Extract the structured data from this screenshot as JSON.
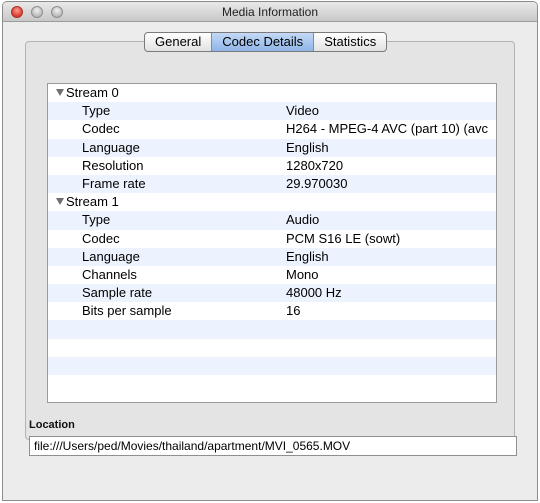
{
  "window": {
    "title": "Media Information"
  },
  "tabs": [
    {
      "label": "General",
      "active": false
    },
    {
      "label": "Codec Details",
      "active": true
    },
    {
      "label": "Statistics",
      "active": false
    }
  ],
  "rows": [
    {
      "kind": "group",
      "label": "Stream 0",
      "value": ""
    },
    {
      "kind": "item",
      "label": "Type",
      "value": "Video"
    },
    {
      "kind": "item",
      "label": "Codec",
      "value": "H264 - MPEG-4 AVC (part 10) (avc"
    },
    {
      "kind": "item",
      "label": "Language",
      "value": "English"
    },
    {
      "kind": "item",
      "label": "Resolution",
      "value": "1280x720"
    },
    {
      "kind": "item",
      "label": "Frame rate",
      "value": "29.970030"
    },
    {
      "kind": "group",
      "label": "Stream 1",
      "value": ""
    },
    {
      "kind": "item",
      "label": "Type",
      "value": "Audio"
    },
    {
      "kind": "item",
      "label": "Codec",
      "value": "PCM S16 LE (sowt)"
    },
    {
      "kind": "item",
      "label": "Language",
      "value": "English"
    },
    {
      "kind": "item",
      "label": "Channels",
      "value": "Mono"
    },
    {
      "kind": "item",
      "label": "Sample rate",
      "value": "48000 Hz"
    },
    {
      "kind": "item",
      "label": "Bits per sample",
      "value": "16"
    }
  ],
  "location": {
    "label": "Location",
    "value": "file:///Users/ped/Movies/thailand/apartment/MVI_0565.MOV"
  }
}
